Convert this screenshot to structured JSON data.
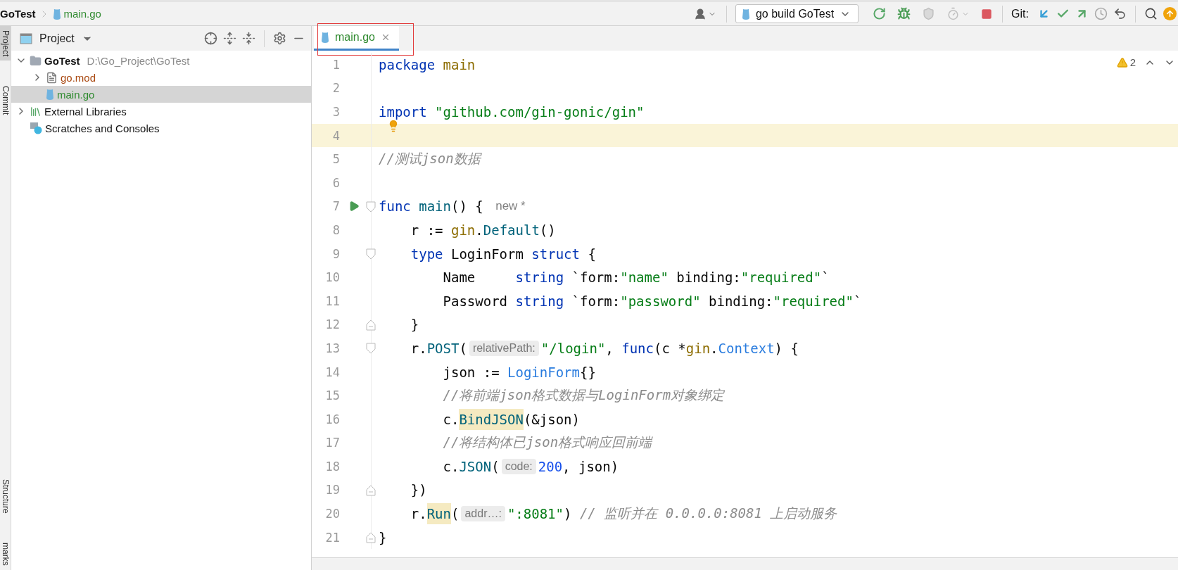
{
  "breadcrumbs": {
    "project": "GoTest",
    "file": "main.go"
  },
  "toolbar": {
    "run_config": "go build GoTest",
    "actions": [
      {
        "kind": "rerun",
        "disabled": false
      },
      {
        "kind": "debug",
        "disabled": false
      },
      {
        "kind": "coverage",
        "disabled": true
      },
      {
        "kind": "profile",
        "disabled": true
      },
      {
        "kind": "stop",
        "disabled": false
      }
    ],
    "git": {
      "label": "Git:",
      "actions": [
        {
          "kind": "update"
        },
        {
          "kind": "commit"
        },
        {
          "kind": "push"
        },
        {
          "kind": "history"
        },
        {
          "kind": "rollback"
        }
      ]
    }
  },
  "side_tabs": {
    "top": [
      {
        "label": "Project",
        "selected": true
      },
      {
        "label": "Commit",
        "selected": false
      }
    ],
    "bottom": [
      {
        "label": "Structure",
        "selected": false
      },
      {
        "label": "marks",
        "selected": false
      }
    ]
  },
  "project_panel": {
    "title": "Project",
    "tree": [
      {
        "label": "GoTest",
        "path": "D:\\Go_Project\\GoTest",
        "kind": "folder",
        "color": "#111111",
        "expanded": true,
        "selected": false,
        "children": [
          {
            "label": "go.mod",
            "kind": "mod",
            "color": "#a94810",
            "expanded": false,
            "selected": false
          },
          {
            "label": "main.go",
            "kind": "go",
            "color": "#2f8a2f",
            "selected": true
          }
        ]
      },
      {
        "label": "External Libraries",
        "kind": "libraries",
        "color": "#111111",
        "expanded": false,
        "selected": false
      },
      {
        "label": "Scratches and Consoles",
        "kind": "scratches",
        "color": "#111111",
        "selected": false
      }
    ]
  },
  "editor": {
    "tabs": [
      {
        "label": "main.go",
        "selected": true,
        "annotated": true
      }
    ],
    "problems": "2",
    "lines": [
      {
        "no": "1",
        "current": false,
        "run": false,
        "tokens": [
          {
            "kind": "kw",
            "t": "package "
          },
          {
            "kind": "pkg",
            "t": "main"
          }
        ]
      },
      {
        "no": "2",
        "current": false,
        "run": false
      },
      {
        "no": "3",
        "current": false,
        "run": false,
        "intention": true,
        "tokens": [
          {
            "kind": "kw",
            "t": "import "
          },
          {
            "kind": "str",
            "t": "\"github.com/gin-gonic/gin\""
          }
        ]
      },
      {
        "no": "4",
        "current": true,
        "run": false
      },
      {
        "no": "5",
        "current": false,
        "run": false,
        "tokens": [
          {
            "kind": "cmt",
            "t": "//测试json数据"
          }
        ]
      },
      {
        "no": "6",
        "current": false,
        "run": false
      },
      {
        "no": "7",
        "current": false,
        "run": true,
        "fold": {
          "kind": "start"
        },
        "tokens": [
          {
            "kind": "kw",
            "t": "func "
          },
          {
            "kind": "call",
            "t": "main"
          },
          {
            "kind": "plain",
            "t": "() { "
          },
          {
            "kind": "author",
            "t": "new *"
          }
        ]
      },
      {
        "no": "8",
        "current": false,
        "run": false,
        "tokens": [
          {
            "kind": "plain",
            "t": "    r := "
          },
          {
            "kind": "pkg",
            "t": "gin"
          },
          {
            "kind": "plain",
            "t": "."
          },
          {
            "kind": "call",
            "t": "Default"
          },
          {
            "kind": "plain",
            "t": "()"
          }
        ]
      },
      {
        "no": "9",
        "current": false,
        "run": false,
        "fold": {
          "kind": "start"
        },
        "tokens": [
          {
            "kind": "kw",
            "t": "    type "
          },
          {
            "kind": "plain",
            "t": "LoginForm "
          },
          {
            "kind": "kw",
            "t": "struct"
          },
          {
            "kind": "plain",
            "t": " {"
          }
        ]
      },
      {
        "no": "10",
        "current": false,
        "run": false,
        "tokens": [
          {
            "kind": "plain",
            "t": "        Name     "
          },
          {
            "kind": "kw",
            "t": "string"
          },
          {
            "kind": "plain",
            "t": " `form:"
          },
          {
            "kind": "str",
            "t": "\"name\""
          },
          {
            "kind": "plain",
            "t": " binding:"
          },
          {
            "kind": "str",
            "t": "\"required\""
          },
          {
            "kind": "plain",
            "t": "`"
          }
        ]
      },
      {
        "no": "11",
        "current": false,
        "run": false,
        "tokens": [
          {
            "kind": "plain",
            "t": "        Password "
          },
          {
            "kind": "kw",
            "t": "string"
          },
          {
            "kind": "plain",
            "t": " `form:"
          },
          {
            "kind": "str",
            "t": "\"password\""
          },
          {
            "kind": "plain",
            "t": " binding:"
          },
          {
            "kind": "str",
            "t": "\"required\""
          },
          {
            "kind": "plain",
            "t": "`"
          }
        ]
      },
      {
        "no": "12",
        "current": false,
        "run": false,
        "fold": {
          "kind": "end"
        },
        "tokens": [
          {
            "kind": "plain",
            "t": "    }"
          }
        ]
      },
      {
        "no": "13",
        "current": false,
        "run": false,
        "fold": {
          "kind": "start"
        },
        "tokens": [
          {
            "kind": "plain",
            "t": "    r."
          },
          {
            "kind": "call",
            "t": "POST"
          },
          {
            "kind": "plain",
            "t": "("
          },
          {
            "kind": "hint",
            "t": "relativePath:"
          },
          {
            "kind": "str",
            "t": "\"/login\""
          },
          {
            "kind": "plain",
            "t": ", "
          },
          {
            "kind": "kw",
            "t": "func"
          },
          {
            "kind": "plain",
            "t": "(c *"
          },
          {
            "kind": "pkg",
            "t": "gin"
          },
          {
            "kind": "plain",
            "t": "."
          },
          {
            "kind": "type",
            "t": "Context"
          },
          {
            "kind": "plain",
            "t": ") {"
          }
        ]
      },
      {
        "no": "14",
        "current": false,
        "run": false,
        "tokens": [
          {
            "kind": "plain",
            "t": "        json := "
          },
          {
            "kind": "type",
            "t": "LoginForm"
          },
          {
            "kind": "plain",
            "t": "{}"
          }
        ]
      },
      {
        "no": "15",
        "current": false,
        "run": false,
        "tokens": [
          {
            "kind": "cmt",
            "t": "        //将前端json格式数据与LoginForm对象绑定"
          }
        ]
      },
      {
        "no": "16",
        "current": false,
        "run": false,
        "tokens": [
          {
            "kind": "plain",
            "t": "        c."
          },
          {
            "kind": "warn",
            "t": "BindJSON"
          },
          {
            "kind": "plain",
            "t": "(&json)"
          }
        ]
      },
      {
        "no": "17",
        "current": false,
        "run": false,
        "tokens": [
          {
            "kind": "cmt",
            "t": "        //将结构体已json格式响应回前端"
          }
        ]
      },
      {
        "no": "18",
        "current": false,
        "run": false,
        "tokens": [
          {
            "kind": "plain",
            "t": "        c."
          },
          {
            "kind": "call",
            "t": "JSON"
          },
          {
            "kind": "plain",
            "t": "("
          },
          {
            "kind": "hint",
            "t": "code:"
          },
          {
            "kind": "num",
            "t": "200"
          },
          {
            "kind": "plain",
            "t": ", json)"
          }
        ]
      },
      {
        "no": "19",
        "current": false,
        "run": false,
        "fold": {
          "kind": "end"
        },
        "tokens": [
          {
            "kind": "plain",
            "t": "    })"
          }
        ]
      },
      {
        "no": "20",
        "current": false,
        "run": false,
        "tokens": [
          {
            "kind": "plain",
            "t": "    r."
          },
          {
            "kind": "warn",
            "t": "Run"
          },
          {
            "kind": "plain",
            "t": "("
          },
          {
            "kind": "hint",
            "t": "addr…:"
          },
          {
            "kind": "str",
            "t": "\":8081\""
          },
          {
            "kind": "plain",
            "t": ") "
          },
          {
            "kind": "cmt",
            "t": "// 监听并在 0.0.0.0:8081 上启动服务"
          }
        ]
      },
      {
        "no": "21",
        "current": false,
        "run": false,
        "fold": {
          "kind": "end"
        },
        "tokens": [
          {
            "kind": "plain",
            "t": "}"
          }
        ]
      }
    ]
  }
}
